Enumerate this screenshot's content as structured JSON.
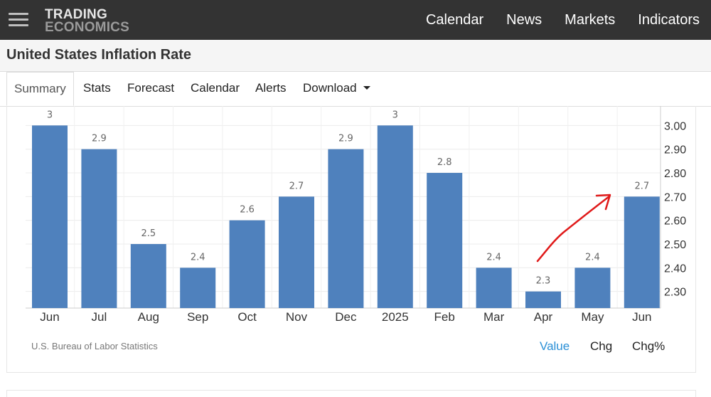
{
  "header": {
    "logo_line1": "TRADING",
    "logo_line2": "ECONOMICS",
    "nav": [
      "Calendar",
      "News",
      "Markets",
      "Indicators"
    ]
  },
  "page_title": "United States Inflation Rate",
  "tabs": [
    {
      "label": "Summary",
      "active": true
    },
    {
      "label": "Stats"
    },
    {
      "label": "Forecast"
    },
    {
      "label": "Calendar"
    },
    {
      "label": "Alerts"
    },
    {
      "label": "Download",
      "dropdown": true
    }
  ],
  "chart_data": {
    "type": "bar",
    "categories": [
      "Jun",
      "Jul",
      "Aug",
      "Sep",
      "Oct",
      "Nov",
      "Dec",
      "2025",
      "Feb",
      "Mar",
      "Apr",
      "May",
      "Jun"
    ],
    "values": [
      3,
      2.9,
      2.5,
      2.4,
      2.6,
      2.7,
      2.9,
      3,
      2.8,
      2.4,
      2.3,
      2.4,
      2.7
    ],
    "value_labels": [
      "3",
      "2.9",
      "2.5",
      "2.4",
      "2.6",
      "2.7",
      "2.9",
      "3",
      "2.8",
      "2.4",
      "2.3",
      "2.4",
      "2.7"
    ],
    "yticks": [
      "3.00",
      "2.90",
      "2.80",
      "2.70",
      "2.60",
      "2.50",
      "2.40",
      "2.30"
    ],
    "ylim": [
      2.23,
      3.04
    ],
    "y_axis_side": "right",
    "grid": true,
    "bar_color": "#4f81bd",
    "annotation": "red hand-drawn arrow pointing up to the final Jun bar",
    "annotation_color": "#e01a1a"
  },
  "source": "U.S. Bureau of Labor Statistics",
  "modes": {
    "value": "Value",
    "chg": "Chg",
    "chg_pct": "Chg%",
    "active_color": "#2a8fd6"
  }
}
